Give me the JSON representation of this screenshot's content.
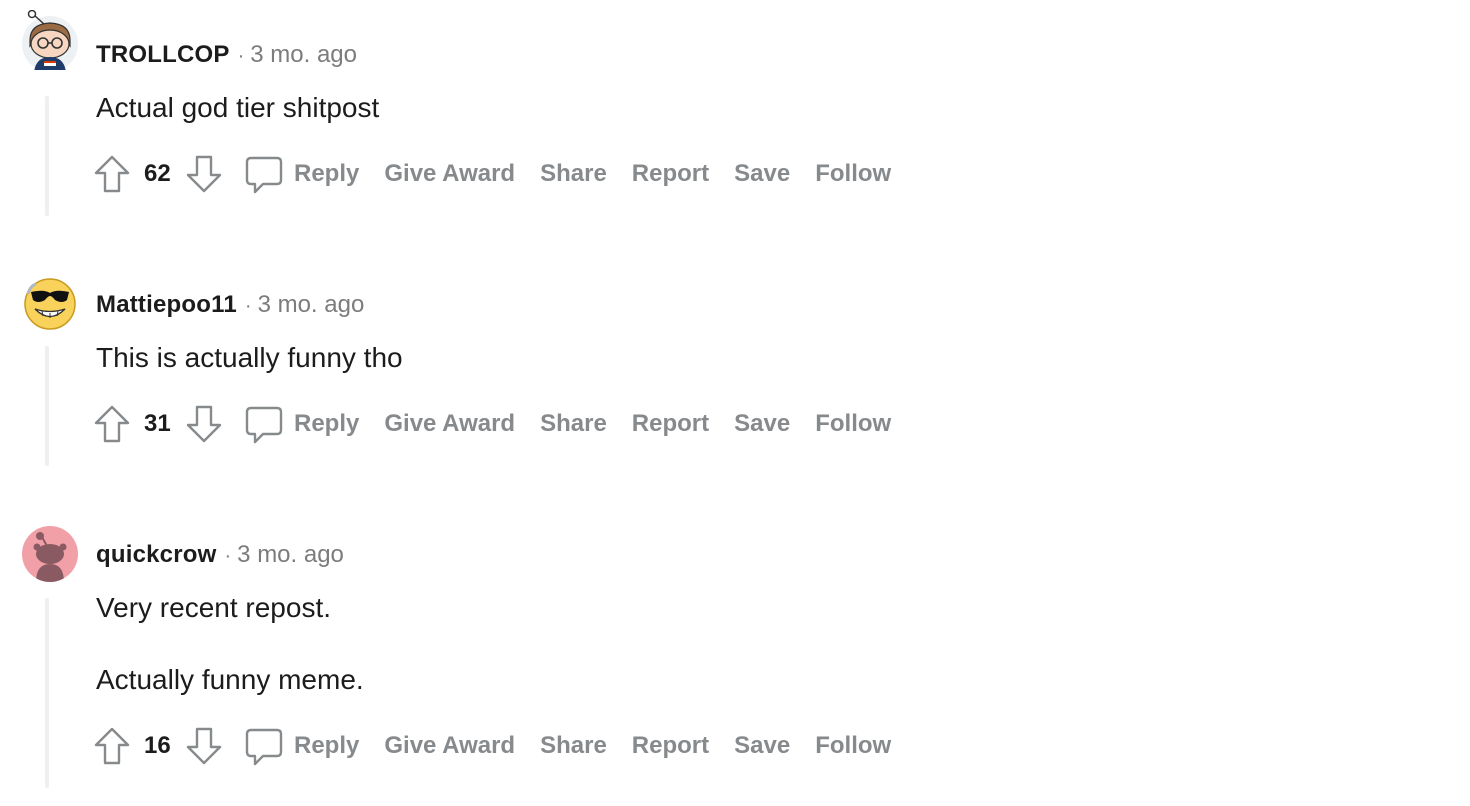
{
  "comments": [
    {
      "username": "TROLLCOP",
      "separator": "·",
      "time": "3 mo. ago",
      "avatar_icon": "snoo-nerd-avatar-icon",
      "body": [
        "Actual god tier shitpost"
      ],
      "score": "62"
    },
    {
      "username": "Mattiepoo11",
      "separator": "·",
      "time": "3 mo. ago",
      "avatar_icon": "sunglasses-smiley-avatar-icon",
      "body": [
        "This is actually funny tho"
      ],
      "score": "31"
    },
    {
      "username": "quickcrow",
      "separator": "·",
      "time": "3 mo. ago",
      "avatar_icon": "default-snoo-avatar-icon",
      "body": [
        "Very recent repost.",
        "Actually funny meme."
      ],
      "score": "16"
    }
  ],
  "actions": {
    "reply": "Reply",
    "give_award": "Give Award",
    "share": "Share",
    "report": "Report",
    "save": "Save",
    "follow": "Follow"
  },
  "colors": {
    "text": "#1c1c1c",
    "meta": "#7c7c7c",
    "action": "#878a8c",
    "thread_line": "#edeff1",
    "default_avatar_bg": "#f2a0a8"
  }
}
